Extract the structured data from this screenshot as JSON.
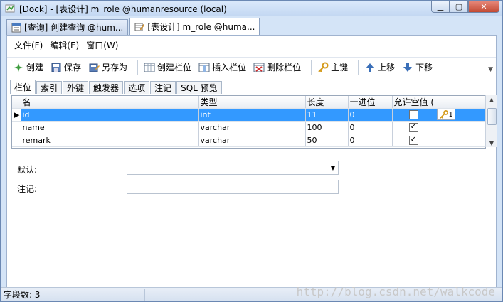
{
  "window": {
    "title": "[Dock] - [表设计] m_role @humanresource (local)"
  },
  "doc_tabs": [
    {
      "label": "[查询] 创建查询 @hum..."
    },
    {
      "label": "[表设计] m_role @huma..."
    }
  ],
  "menu": [
    {
      "label": "文件(F)"
    },
    {
      "label": "编辑(E)"
    },
    {
      "label": "窗口(W)"
    }
  ],
  "toolbar": {
    "new_label": "创建",
    "save_label": "保存",
    "save_as_label": "另存为",
    "create_col_label": "创建栏位",
    "insert_col_label": "插入栏位",
    "delete_col_label": "删除栏位",
    "pk_label": "主键",
    "move_up_label": "上移",
    "move_down_label": "下移"
  },
  "sub_tabs": [
    {
      "label": "栏位"
    },
    {
      "label": "索引"
    },
    {
      "label": "外键"
    },
    {
      "label": "触发器"
    },
    {
      "label": "选项"
    },
    {
      "label": "注记"
    },
    {
      "label": "SQL 预览"
    }
  ],
  "grid": {
    "headers": [
      "名",
      "类型",
      "长度",
      "十进位",
      "允许空值 (",
      ""
    ],
    "rows": [
      {
        "name": "id",
        "type": "int",
        "length": "11",
        "decimal": "0",
        "allow_null": false,
        "key": "1"
      },
      {
        "name": "name",
        "type": "varchar",
        "length": "100",
        "decimal": "0",
        "allow_null": true,
        "key": ""
      },
      {
        "name": "remark",
        "type": "varchar",
        "length": "50",
        "decimal": "0",
        "allow_null": true,
        "key": ""
      }
    ]
  },
  "form": {
    "default_label": "默认:",
    "comment_label": "注记:"
  },
  "status": {
    "field_count": "字段数: 3"
  },
  "watermark": "http://blog.csdn.net/walkcode",
  "colors": {
    "selection": "#3399ff",
    "title_bg": "#c2d7f2"
  }
}
